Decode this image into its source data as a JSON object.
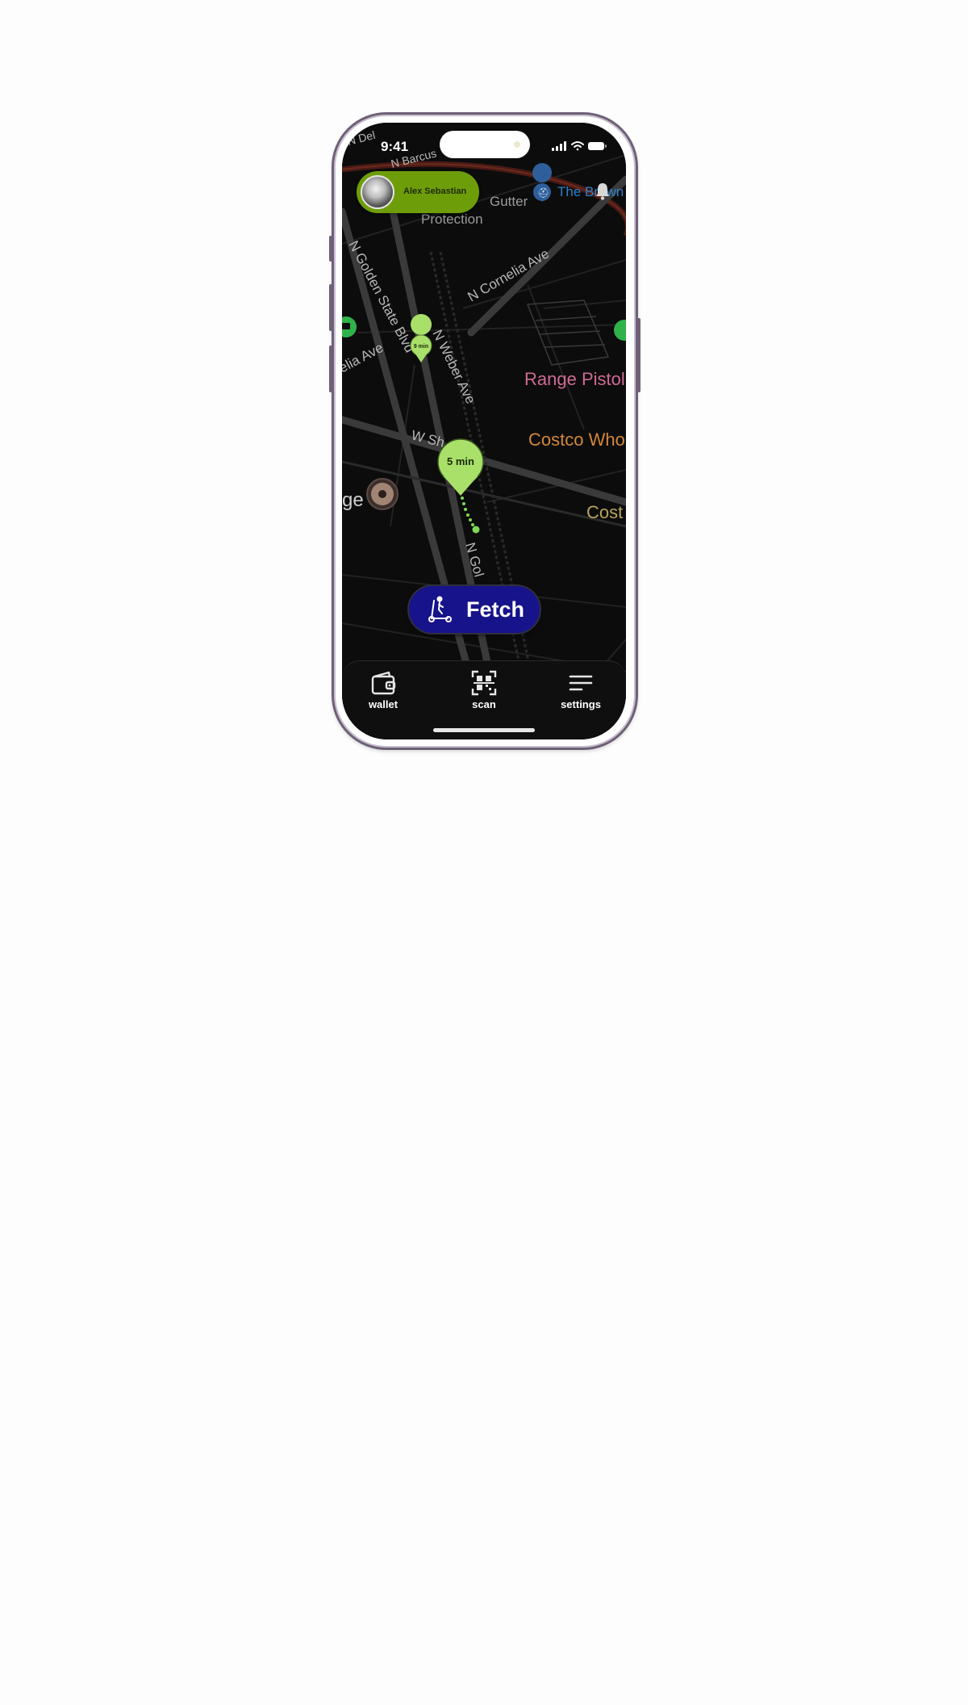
{
  "status_bar": {
    "time": "9:41"
  },
  "profile": {
    "name": "Alex Sebastian"
  },
  "map": {
    "streets": [
      "N Golden State Blvd",
      "N Weber Ave",
      "N Cornelia Ave",
      "W Sh",
      "elia Ave",
      "N Gol",
      "N Del",
      "N Barcus"
    ],
    "places": [
      {
        "label": "Range Pistol",
        "color": "#d06a94"
      },
      {
        "label": "Costco Who",
        "color": "#d3873a"
      },
      {
        "label": "Cost",
        "color": "#b8a45a"
      },
      {
        "label": "The Brown",
        "color": "#2f7fc9"
      },
      {
        "label": "Gutter",
        "color": "#9a9a9a"
      },
      {
        "label": "Protection",
        "color": "#9a9a9a"
      },
      {
        "label": "ge",
        "color": "#cfcfcf"
      }
    ],
    "pins": [
      {
        "label": "5 min",
        "color": "#a8e06a"
      },
      {
        "label": "9 min",
        "color": "#a8e06a"
      }
    ]
  },
  "fetch_button": {
    "label": "Fetch",
    "icon": "scooter-icon",
    "color": "#17138a"
  },
  "bottom_nav": {
    "items": [
      {
        "label": "wallet",
        "icon": "wallet-icon"
      },
      {
        "label": "scan",
        "icon": "qr-scan-icon"
      },
      {
        "label": "settings",
        "icon": "menu-lines-icon"
      }
    ]
  },
  "colors": {
    "accent": "#6e9d0a",
    "pin": "#a8e06a",
    "fetch": "#17138a"
  }
}
